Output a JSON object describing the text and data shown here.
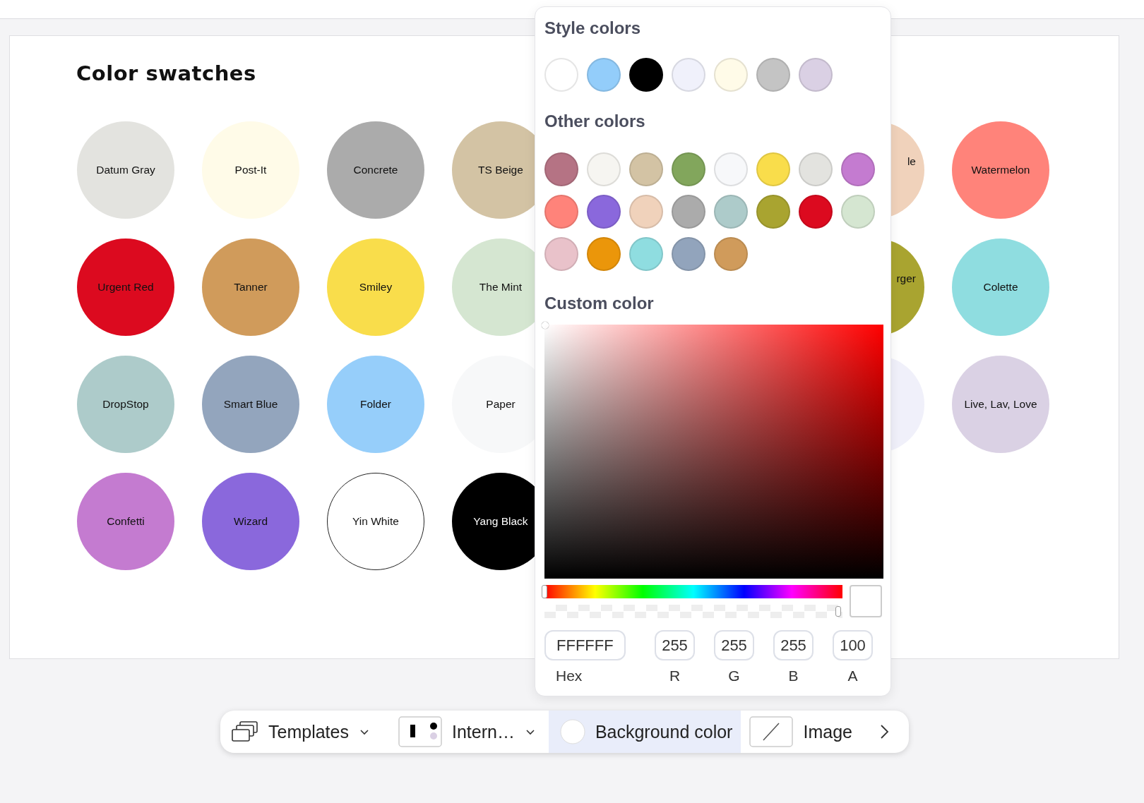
{
  "board": {
    "title": "Color swatches",
    "rows": [
      {
        "left": [
          {
            "name": "Datum Gray",
            "color": "#e3e3df"
          },
          {
            "name": "Post-It",
            "color": "#fffbe8"
          },
          {
            "name": "Concrete",
            "color": "#ababab"
          },
          {
            "name": "TS Beige",
            "color": "#d3c3a4"
          }
        ],
        "right": [
          {
            "name": "le",
            "color": "#f0d2bb",
            "kind": "clipped"
          },
          {
            "name": "Watermelon",
            "color": "#ff837a",
            "kind": "full"
          }
        ]
      },
      {
        "left": [
          {
            "name": "Urgent Red",
            "color": "#dc0a1f"
          },
          {
            "name": "Tanner",
            "color": "#d09b5b"
          },
          {
            "name": "Smiley",
            "color": "#f9dd4b"
          },
          {
            "name": "The Mint",
            "color": "#d5e6d1"
          }
        ],
        "right": [
          {
            "name": "rger",
            "color": "#a9a430",
            "kind": "clipped"
          },
          {
            "name": "Colette",
            "color": "#8fdde0",
            "kind": "full"
          }
        ]
      },
      {
        "left": [
          {
            "name": "DropStop",
            "color": "#adcbca"
          },
          {
            "name": "Smart Blue",
            "color": "#93a5bd"
          },
          {
            "name": "Folder",
            "color": "#96cefa"
          },
          {
            "name": "Paper",
            "color": "#f7f8f9"
          }
        ],
        "right": [
          {
            "color": "#f0f0fa",
            "kind": "clipped"
          },
          {
            "name": "Live, Lav, Love",
            "color": "#dad1e4",
            "kind": "full"
          }
        ]
      },
      {
        "left": [
          {
            "name": "Confetti",
            "color": "#c47bd0"
          },
          {
            "name": "Wizard",
            "color": "#8a68dc"
          },
          {
            "name": "Yin White",
            "color": "#ffffff"
          },
          {
            "name": "Yang Black",
            "color": "#000000"
          }
        ]
      }
    ]
  },
  "color_picker": {
    "style_colors": {
      "title": "Style colors",
      "dots": [
        {
          "color": "#ffffff"
        },
        {
          "color": "#93cdfa"
        },
        {
          "color": "#000000"
        },
        {
          "color": "#f0f1fb"
        },
        {
          "color": "#fffbe8"
        },
        {
          "color": "#c4c4c4"
        },
        {
          "color": "#dad0e4"
        }
      ]
    },
    "other_colors": {
      "title": "Other colors",
      "dots": [
        {
          "color": "#b57384"
        },
        {
          "color": "#f6f5f1"
        },
        {
          "color": "#d3c3a4"
        },
        {
          "color": "#82a65c"
        },
        {
          "color": "#f7f8fa"
        },
        {
          "color": "#f9dd4b"
        },
        {
          "color": "#e3e3df"
        },
        {
          "color": "#c47bd0"
        },
        {
          "color": "#ff837a"
        },
        {
          "color": "#8a68dc"
        },
        {
          "color": "#f0d2bb"
        },
        {
          "color": "#ababab"
        },
        {
          "color": "#adcbca"
        },
        {
          "color": "#a9a430"
        },
        {
          "color": "#dc0a1f"
        },
        {
          "color": "#d5e6d1"
        },
        {
          "color": "#e9c2ca"
        },
        {
          "color": "#eb960a"
        },
        {
          "color": "#8fdde0"
        },
        {
          "color": "#92a4bc"
        },
        {
          "color": "#d09b5b"
        }
      ]
    },
    "custom": {
      "title": "Custom color",
      "hue": {
        "level": 0
      },
      "alpha": {
        "level": 1
      },
      "fields": [
        {
          "label": "Hex",
          "value": "FFFFFF",
          "kind": "wide"
        },
        {
          "label": "R",
          "value": "255",
          "kind": "narrow"
        },
        {
          "label": "G",
          "value": "255",
          "kind": "narrow"
        },
        {
          "label": "B",
          "value": "255",
          "kind": "narrow"
        },
        {
          "label": "A",
          "value": "100",
          "kind": "narrow"
        }
      ]
    }
  },
  "toolbar": {
    "items": [
      {
        "kind": "templates",
        "label": "Templates",
        "selected": false
      },
      {
        "kind": "layout",
        "label": "Intern…",
        "selected": false
      },
      {
        "kind": "background",
        "label": "Background color",
        "selected": true
      },
      {
        "kind": "image",
        "label": "Image",
        "selected": false
      }
    ]
  }
}
